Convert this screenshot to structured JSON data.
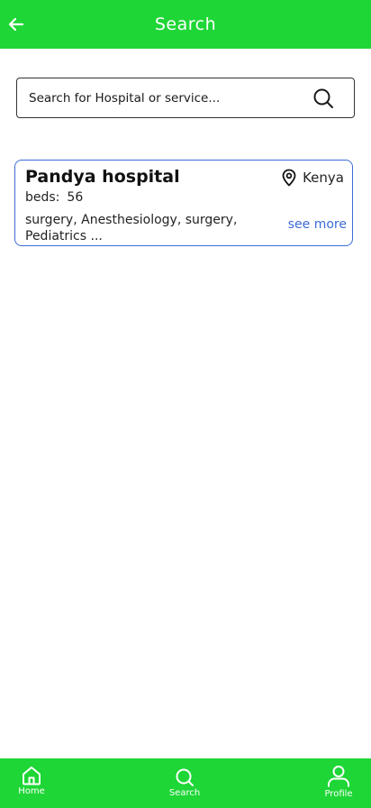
{
  "header": {
    "title": "Search",
    "back_icon": "arrow-left-icon",
    "background": "#1ed636"
  },
  "search": {
    "placeholder": "Search for Hospital or service...",
    "value": "",
    "icon": "search-icon"
  },
  "results": [
    {
      "name": "Pandya hospital",
      "location": "Kenya",
      "beds_label": "beds:",
      "beds_value": "56",
      "services": "surgery, Anesthesiology, surgery, Pediatrics ...",
      "more_label": "see more",
      "location_icon": "map-pin-icon"
    }
  ],
  "bottom_nav": {
    "home_label": "Home",
    "search_label": "Search",
    "profile_label": "Profile"
  },
  "colors": {
    "accent": "#1ed636",
    "link": "#3c6bd6"
  }
}
